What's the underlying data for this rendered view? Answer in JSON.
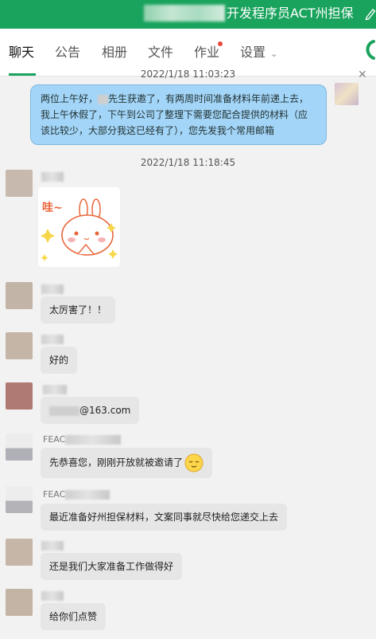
{
  "header": {
    "title": "开发程序员ACT州担保"
  },
  "tabs": [
    {
      "label": "聊天"
    },
    {
      "label": "公告"
    },
    {
      "label": "相册"
    },
    {
      "label": "文件"
    },
    {
      "label": "作业"
    },
    {
      "label": "设置"
    }
  ],
  "messages": {
    "ts1": "2022/1/18 11:03:23",
    "me_text_a": "两位上午好，",
    "me_text_b": "先生获邀了，有两周时间准备材料年前递上去，我上午休假了，下午到公司了整理下需要您配合提供的材料（应该比较少，大部分我这已经有了），您先发我个常用邮箱",
    "ts2": "2022/1/18 11:18:45",
    "sticker_text": "哇~",
    "m2": "太厉害了！！",
    "m3": "好的",
    "m4_suffix": "@163.com",
    "m5_name": "FEAC",
    "m5": "先恭喜您，刚刚开放就被邀请了",
    "m6_name": "FEAC",
    "m6": "最近准备好州担保材料，文案同事就尽快给您递交上去",
    "m7": "还是我们大家准备工作做得好",
    "m8": "给你们点赞"
  },
  "colors": {
    "header": "#19a35d",
    "my_bubble": "#a3d5f8",
    "other_bubble": "#e6e6e6",
    "unread_dot": "#e84a3b"
  }
}
